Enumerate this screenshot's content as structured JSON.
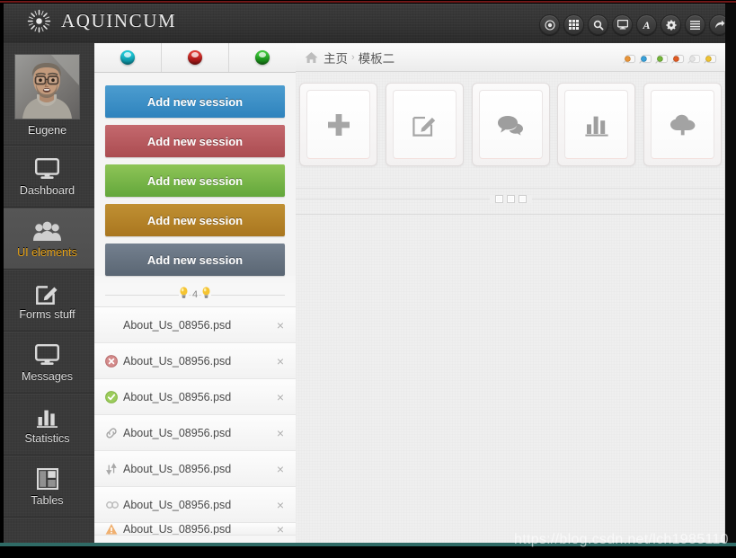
{
  "header": {
    "brand": "AQUINCUM",
    "logo_icon": "sun-starburst-icon",
    "tools": [
      {
        "name": "record-icon",
        "label": "Record"
      },
      {
        "name": "grid-icon",
        "label": "Grid"
      },
      {
        "name": "search-icon",
        "label": "Search"
      },
      {
        "name": "monitor-icon",
        "label": "Display"
      },
      {
        "name": "typography-icon",
        "label": "A"
      },
      {
        "name": "gear-icon",
        "label": "Settings"
      },
      {
        "name": "list-icon",
        "label": "List"
      },
      {
        "name": "logout-arrow-icon",
        "label": "Logout"
      }
    ]
  },
  "sidebar": {
    "profile": {
      "name": "Eugene",
      "avatar_alt": "user-avatar"
    },
    "items": [
      {
        "label": "Dashboard",
        "icon": "monitor-icon",
        "active": false
      },
      {
        "label": "UI elements",
        "icon": "users-group-icon",
        "active": true
      },
      {
        "label": "Forms stuff",
        "icon": "edit-square-icon",
        "active": false
      },
      {
        "label": "Messages",
        "icon": "monitor-icon",
        "active": false
      },
      {
        "label": "Statistics",
        "icon": "bar-chart-icon",
        "active": false
      },
      {
        "label": "Tables",
        "icon": "table-layout-icon",
        "active": false
      }
    ],
    "active_color": "#e8a317"
  },
  "panel": {
    "tabs": [
      {
        "name": "tab-cyan",
        "orb": "cyan",
        "color": "#1fc9d8"
      },
      {
        "name": "tab-red",
        "orb": "red",
        "color": "#e03b34"
      },
      {
        "name": "tab-green",
        "orb": "green",
        "color": "#3ec83a"
      }
    ],
    "buttons": [
      {
        "label": "Add new session",
        "color": "#2f83bd",
        "variant": "b1"
      },
      {
        "label": "Add new session",
        "color": "#ab4c51",
        "variant": "b2"
      },
      {
        "label": "Add new session",
        "color": "#63a73b",
        "variant": "b3"
      },
      {
        "label": "Add new session",
        "color": "#a9761f",
        "variant": "b4"
      },
      {
        "label": "Add new session",
        "color": "#5a6673",
        "variant": "b5"
      }
    ],
    "divider": {
      "count": "4",
      "icon_left": "lightbulb-icon",
      "icon_right": "lightbulb-icon"
    },
    "files": [
      {
        "name": "About_Us_08956.psd",
        "icon": "none",
        "close": "×"
      },
      {
        "name": "About_Us_08956.psd",
        "icon": "error-circle-icon",
        "close": "×"
      },
      {
        "name": "About_Us_08956.psd",
        "icon": "check-circle-icon",
        "close": "×"
      },
      {
        "name": "About_Us_08956.psd",
        "icon": "link-chain-icon",
        "close": "×"
      },
      {
        "name": "About_Us_08956.psd",
        "icon": "sort-arrows-icon",
        "close": "×"
      },
      {
        "name": "About_Us_08956.psd",
        "icon": "infinity-link-icon",
        "close": "×"
      },
      {
        "name": "About_Us_08956.psd",
        "icon": "warning-icon",
        "close": "×"
      }
    ]
  },
  "main": {
    "breadcrumb": {
      "home_icon": "home-icon",
      "items": [
        "主页",
        "模板二"
      ],
      "separator": "›"
    },
    "pins": [
      {
        "name": "pin-orange",
        "color": "#e8943a"
      },
      {
        "name": "pin-blue",
        "color": "#3aa0d8"
      },
      {
        "name": "pin-green",
        "color": "#74b53a"
      },
      {
        "name": "pin-red",
        "color": "#e05b23"
      },
      {
        "name": "pin-gray",
        "color": "#d4d4d4"
      },
      {
        "name": "pin-yellow",
        "color": "#eec233"
      }
    ],
    "cards": [
      {
        "icon": "plus-icon",
        "name": "card-add"
      },
      {
        "icon": "edit-square-icon",
        "name": "card-edit"
      },
      {
        "icon": "chat-bubbles-icon",
        "name": "card-messages"
      },
      {
        "icon": "bar-chart-icon",
        "name": "card-statistics"
      },
      {
        "icon": "cloud-upload-icon",
        "name": "card-upload"
      }
    ],
    "carousel_dots": 3
  },
  "watermark": "https://blog.csdn.net/lch1985110"
}
